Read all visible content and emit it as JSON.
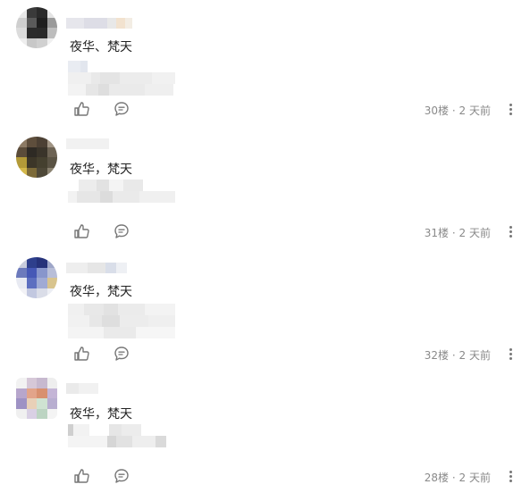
{
  "comments": [
    {
      "content": "夜华、梵天",
      "floor": "30楼",
      "time": "2 天前",
      "separator": "·"
    },
    {
      "content": "夜华，梵天",
      "floor": "31楼",
      "time": "2 天前",
      "separator": "·"
    },
    {
      "content": "夜华，梵天",
      "floor": "32楼",
      "time": "2 天前",
      "separator": "·"
    },
    {
      "content": "夜华，梵天",
      "floor": "28楼",
      "time": "2 天前",
      "separator": "·"
    }
  ],
  "icons": {
    "like": "thumbs-up-icon",
    "reply": "comment-bubble-icon",
    "more": "more-vertical-icon"
  },
  "colors": {
    "text": "#222222",
    "meta": "#8a8a8a",
    "icon": "#777777"
  }
}
